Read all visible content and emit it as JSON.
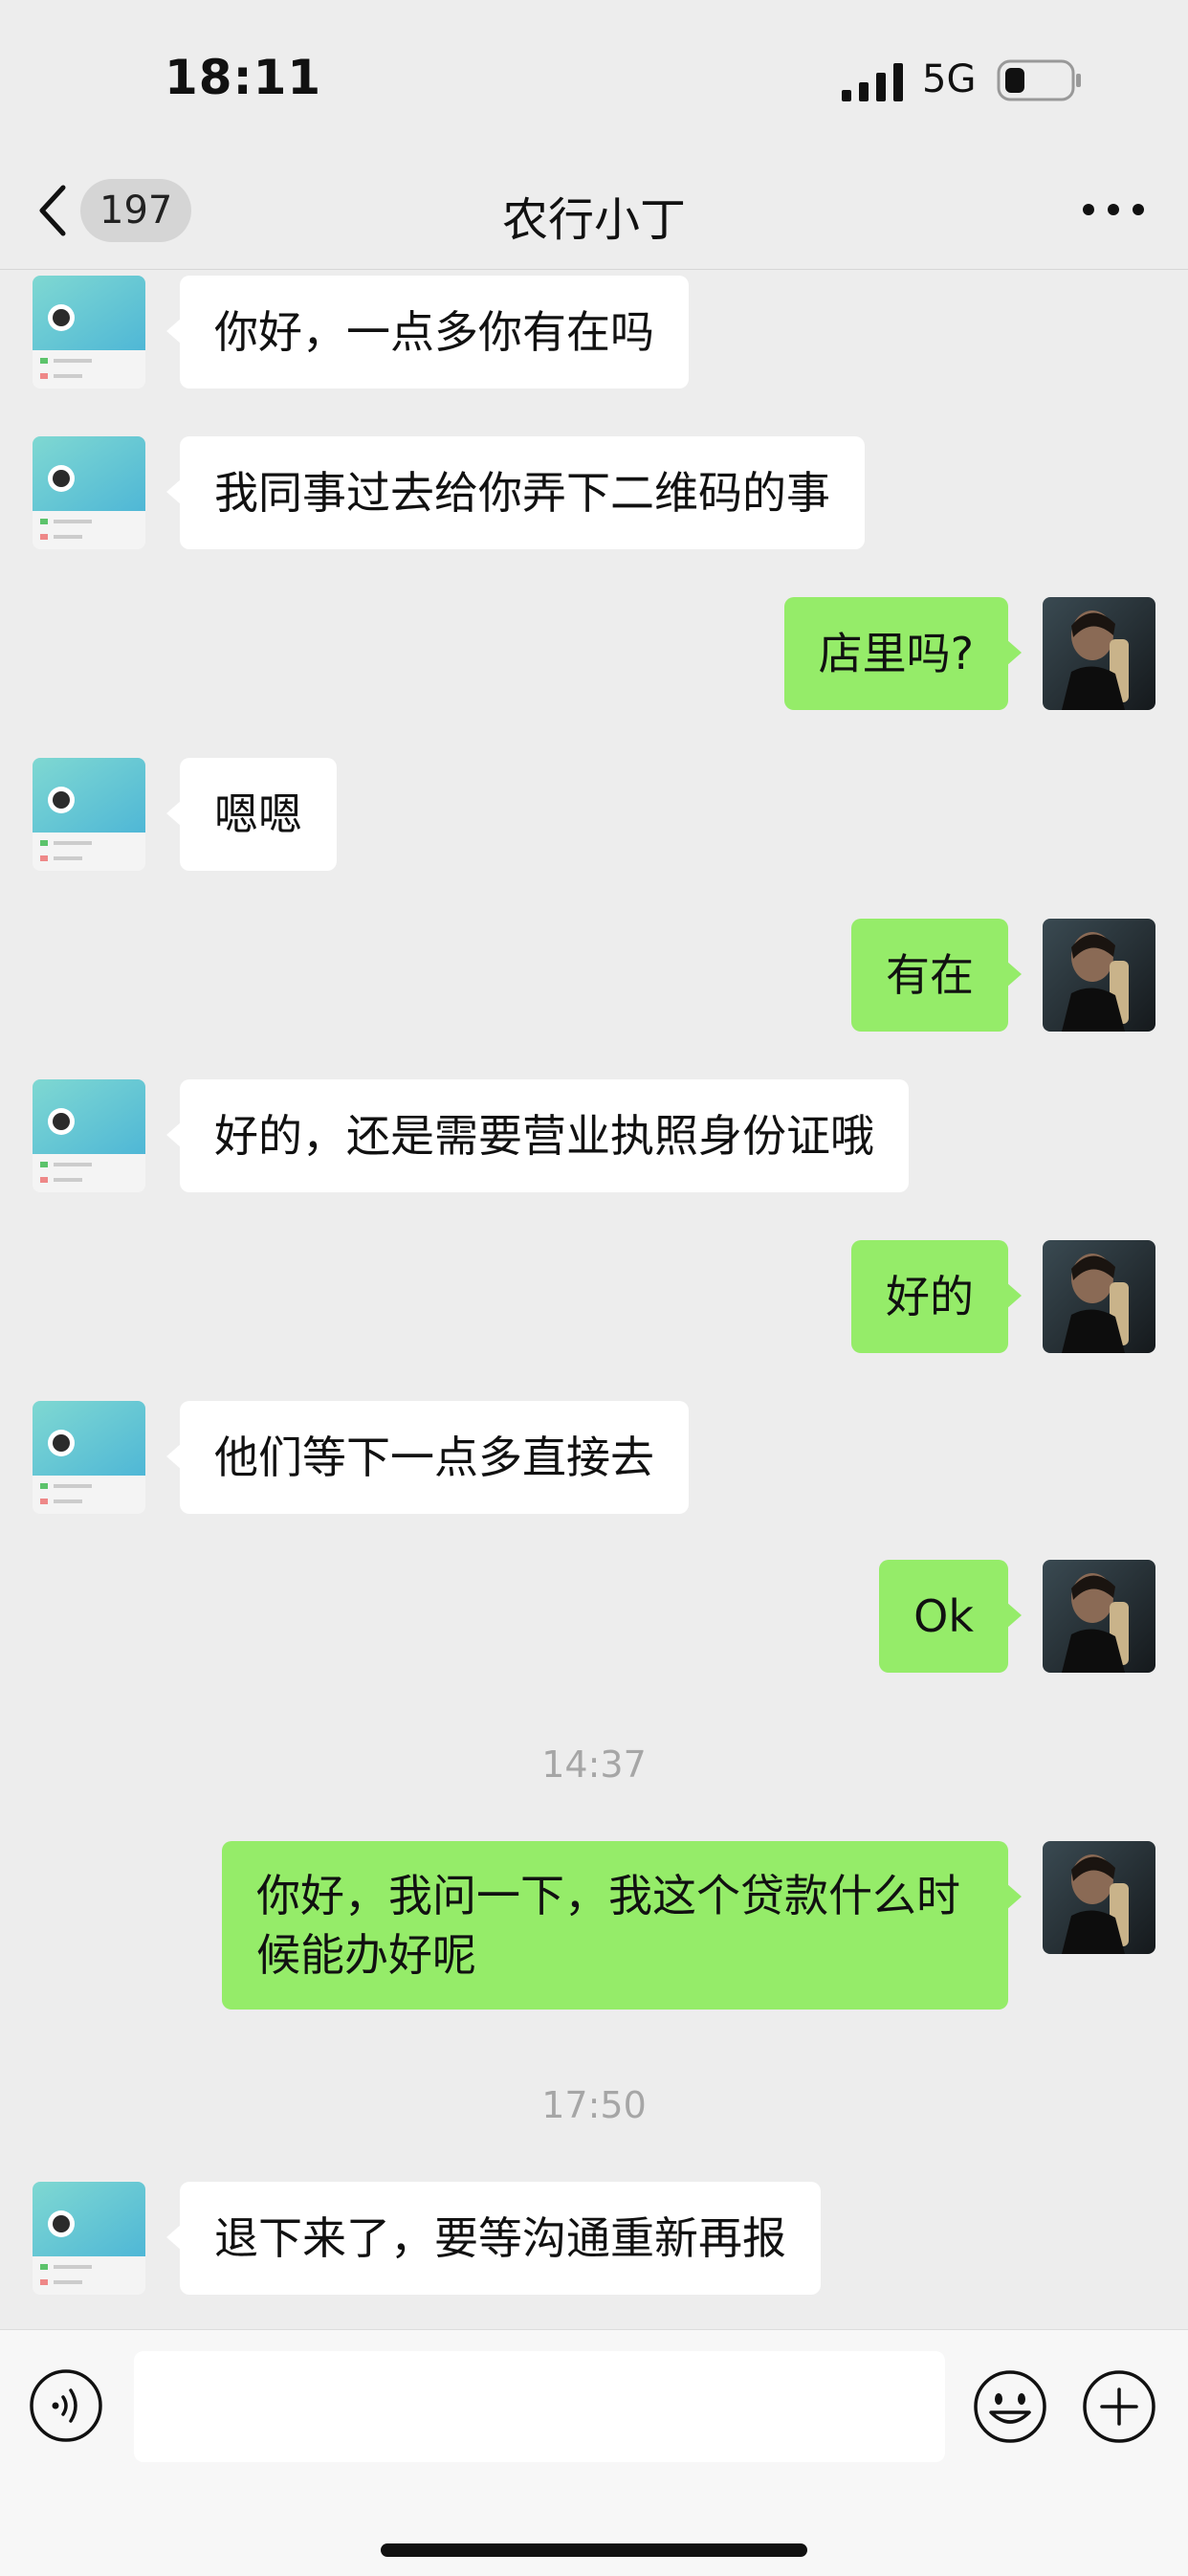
{
  "status_bar": {
    "time": "18:11",
    "network": "5G",
    "icons": [
      "signal-icon",
      "battery-icon"
    ]
  },
  "nav": {
    "back_badge": "197",
    "title": "农行小丁",
    "icons": [
      "back-chevron-icon",
      "more-icon"
    ]
  },
  "messages": [
    {
      "side": "left",
      "text": "你好，一点多你有在吗"
    },
    {
      "side": "left",
      "text": "我同事过去给你弄下二维码的事"
    },
    {
      "side": "right",
      "text": "店里吗?"
    },
    {
      "side": "left",
      "text": "嗯嗯"
    },
    {
      "side": "right",
      "text": "有在"
    },
    {
      "side": "left",
      "text": "好的，还是需要营业执照身份证哦"
    },
    {
      "side": "right",
      "text": "好的"
    },
    {
      "side": "left",
      "text": "他们等下一点多直接去"
    },
    {
      "side": "right",
      "text": "Ok"
    },
    {
      "type": "timestamp",
      "text": "14:37"
    },
    {
      "side": "right",
      "text": "你好，我问一下，我这个贷款什么时候能办好呢"
    },
    {
      "type": "timestamp",
      "text": "17:50"
    },
    {
      "side": "left",
      "text": "退下来了，要等沟通重新再报"
    }
  ],
  "input_bar": {
    "value": "",
    "icons": [
      "voice-icon",
      "emoji-icon",
      "plus-icon"
    ]
  },
  "colors": {
    "background": "#ededed",
    "sent_bubble": "#95ec69",
    "received_bubble": "#ffffff"
  }
}
